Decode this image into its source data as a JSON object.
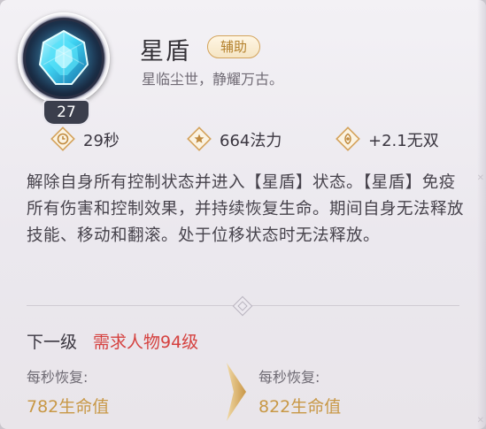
{
  "skill": {
    "name": "星盾",
    "tag": "辅助",
    "tagline": "星临尘世，静耀万古。",
    "level": "27",
    "icon": "star-shield-crystal-icon"
  },
  "stats": [
    {
      "icon": "clock-icon",
      "text": "29秒"
    },
    {
      "icon": "star-diamond-icon",
      "text": "664法力"
    },
    {
      "icon": "swirl-diamond-icon",
      "text": "+2.1无双"
    }
  ],
  "description": "解除自身所有控制状态并进入【星盾】状态。【星盾】免疫所有伤害和控制效果，并持续恢复生命。期间自身无法释放技能、移动和翻滚。处于位移状态时无法释放。",
  "next_level": {
    "label": "下一级",
    "requirement": "需求人物94级",
    "current": {
      "label": "每秒恢复:",
      "value": "782生命值"
    },
    "next": {
      "label": "每秒恢复:",
      "value": "822生命值"
    }
  },
  "colors": {
    "accent_gold": "#c89846",
    "requirement_red": "#d5413f",
    "tag_border": "#d3a35a"
  }
}
